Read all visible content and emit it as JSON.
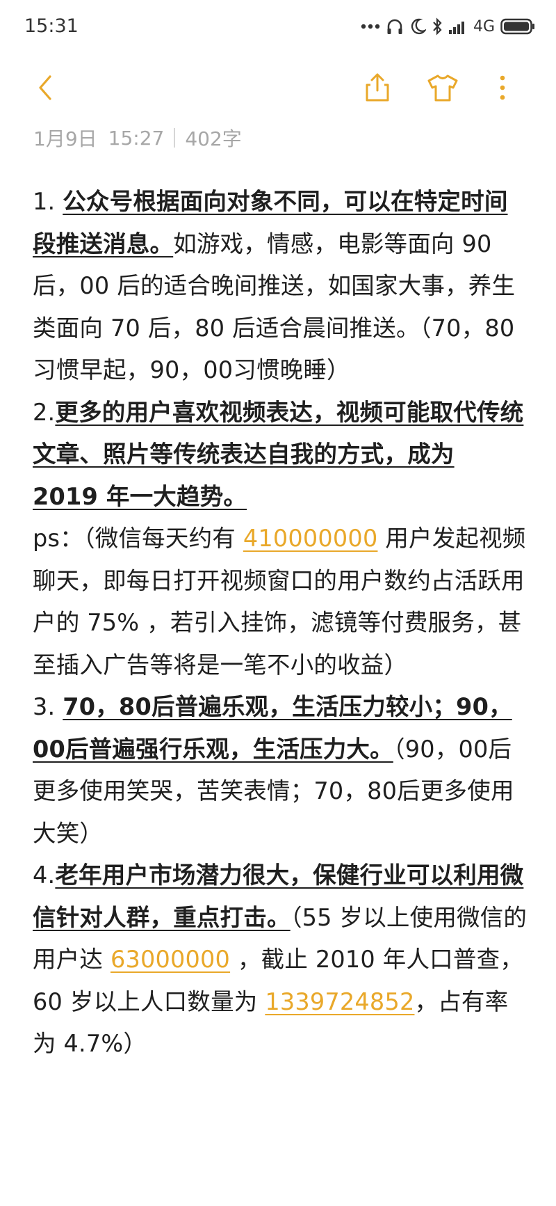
{
  "status_bar": {
    "time": "15:31",
    "network_label": "4G",
    "icons": [
      "dots-icon",
      "headphone-icon",
      "moon-icon",
      "bluetooth-icon",
      "signal-icon",
      "battery-icon"
    ]
  },
  "toolbar": {
    "icons": [
      "back-chevron-icon",
      "share-icon",
      "tshirt-theme-icon",
      "more-vertical-icon"
    ],
    "accent_color": "#e9a82a"
  },
  "meta": {
    "date": "1月9日",
    "time": "15:27",
    "word_count": "402字"
  },
  "note": {
    "p1": {
      "prefix": "1. ",
      "underlined": "公众号根据面向对象不同，可以在特定时间段推送消息。",
      "rest": "如游戏，情感，电影等面向 90 后，00 后的适合晚间推送，如国家大事，养生类面向 70 后，80 后适合晨间推送。（70，80 习惯早起，90，00习惯晚睡）"
    },
    "p2": {
      "prefix": "2.",
      "underlined": "更多的用户喜欢视频表达，视频可能取代传统文章、照片等传统表达自我的方式，成为 2019  年一大趋势。"
    },
    "ps": {
      "before": "ps：（微信每天约有 ",
      "number": "410000000",
      "after": " 用户发起视频聊天，即每日打开视频窗口的用户数约占活跃用户的 75% ，若引入挂饰，滤镜等付费服务，甚至插入广告等将是一笔不小的收益）"
    },
    "p3": {
      "prefix": "3. ",
      "underlined": "70，80后普遍乐观，生活压力较小；90，00后普遍强行乐观，生活压力大。",
      "rest": "（90，00后更多使用笑哭，苦笑表情；70，80后更多使用大笑）"
    },
    "p4": {
      "prefix": "4.",
      "underlined": "老年用户市场潜力很大，保健行业可以利用微信针对人群，重点打击。",
      "rest1": "（55 岁以上使用微信的用户达 ",
      "number1": "63000000",
      "rest2": " ，截止 2010 年人口普查，60 岁以上人口数量为 ",
      "number2": "1339724852",
      "rest3": "，占有率为 4.7%）"
    }
  }
}
